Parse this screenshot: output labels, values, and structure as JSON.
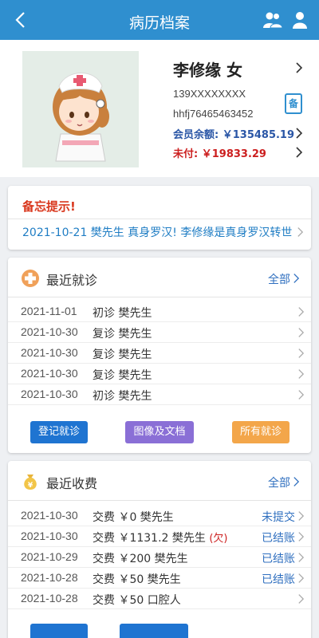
{
  "header": {
    "title": "病历档案"
  },
  "patient": {
    "name_gender": "李修缘 女",
    "phone": "139XXXXXXXX",
    "code": "hhfj76465463452",
    "record_badge": "备",
    "balance": "会员余额: ￥135485.19",
    "unpaid": "未付: ￥19833.29"
  },
  "memo": {
    "title": "备忘提示!",
    "text": "2021-10-21  樊先生  真身罗汉!  李修缘是真身罗汉转世"
  },
  "visits": {
    "title": "最近就诊",
    "all_label": "全部",
    "rows": [
      {
        "date": "2021-11-01",
        "desc": "初诊 樊先生"
      },
      {
        "date": "2021-10-30",
        "desc": "复诊 樊先生"
      },
      {
        "date": "2021-10-30",
        "desc": "复诊 樊先生"
      },
      {
        "date": "2021-10-30",
        "desc": "复诊 樊先生"
      },
      {
        "date": "2021-10-30",
        "desc": "初诊 樊先生"
      }
    ],
    "buttons": {
      "register": "登记就诊",
      "images_docs": "图像及文档",
      "all_visits": "所有就诊"
    }
  },
  "fees": {
    "title": "最近收费",
    "all_label": "全部",
    "rows": [
      {
        "date": "2021-10-30",
        "desc": "交费 ￥0 樊先生",
        "tag": "",
        "status": "未提交"
      },
      {
        "date": "2021-10-30",
        "desc": "交费 ￥1131.2 樊先生",
        "tag": "(欠)",
        "status": "已结账"
      },
      {
        "date": "2021-10-29",
        "desc": "交费 ￥200 樊先生",
        "tag": "",
        "status": "已结账"
      },
      {
        "date": "2021-10-28",
        "desc": "交费 ￥50 樊先生",
        "tag": "",
        "status": "已结账"
      },
      {
        "date": "2021-10-28",
        "desc": "交费 ￥50 口腔人",
        "tag": "",
        "status": ""
      }
    ]
  },
  "colors": {
    "header": "#2f8fcf",
    "register_btn": "#1f74d1",
    "images_btn": "#8a6fd6",
    "all_visits_btn": "#f3a64a",
    "unpaid": "#cc1f1f",
    "balance": "#2a56a6"
  },
  "icons": [
    "back-arrow-icon",
    "patients-group-icon",
    "user-icon",
    "record-note-icon",
    "medical-cross-icon",
    "money-bag-icon",
    "chevron-right-icon"
  ]
}
